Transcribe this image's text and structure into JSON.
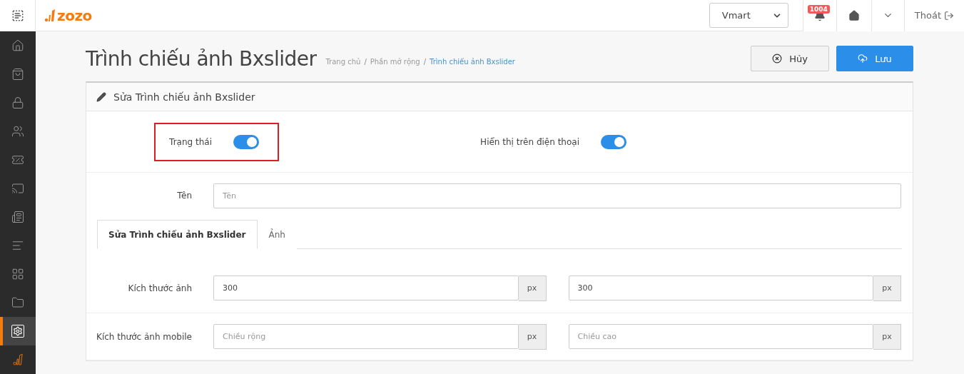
{
  "topbar": {
    "logo": "zozo",
    "store_select": {
      "value": "Vmart"
    },
    "notifications": {
      "count": "1004"
    },
    "logout": "Thoát"
  },
  "sidebar": {
    "items": [
      {
        "selected": false
      },
      {
        "selected": false
      },
      {
        "selected": false
      },
      {
        "selected": false
      },
      {
        "selected": false
      },
      {
        "selected": false
      },
      {
        "selected": false
      },
      {
        "selected": false
      },
      {
        "selected": false
      },
      {
        "selected": false
      },
      {
        "selected": true
      }
    ]
  },
  "page": {
    "title": "Trình chiếu ảnh Bxslider",
    "breadcrumb": [
      "Trang chủ",
      "Phần mở rộng",
      "Trình chiếu ảnh Bxslider"
    ],
    "breadcrumb_separator": "/",
    "buttons": [
      {
        "kind": "cancel",
        "label": "Hủy"
      },
      {
        "kind": "save",
        "label": "Lưu"
      }
    ]
  },
  "card": {
    "title": "Sửa Trình chiếu ảnh Bxslider",
    "toggles": [
      {
        "label": "Trạng thái",
        "on": true,
        "highlighted": true
      },
      {
        "label": "Hiển thị trên điện thoại",
        "on": true,
        "highlighted": false
      }
    ],
    "name_field": {
      "label": "Tên",
      "placeholder": "Tên"
    },
    "tabs": [
      {
        "label": "Sửa Trình chiếu ảnh Bxslider",
        "selected": true
      },
      {
        "label": "Ảnh",
        "selected": false
      }
    ],
    "size_rows": [
      {
        "label": "Kích thước ảnh",
        "fields": [
          {
            "value": "300",
            "unit": "px"
          },
          {
            "value": "300",
            "unit": "px"
          }
        ]
      },
      {
        "label": "Kích thước ảnh mobile",
        "fields": [
          {
            "placeholder": "Chiều rộng",
            "unit": "px"
          },
          {
            "placeholder": "Chiều cao",
            "unit": "px"
          }
        ]
      }
    ]
  }
}
